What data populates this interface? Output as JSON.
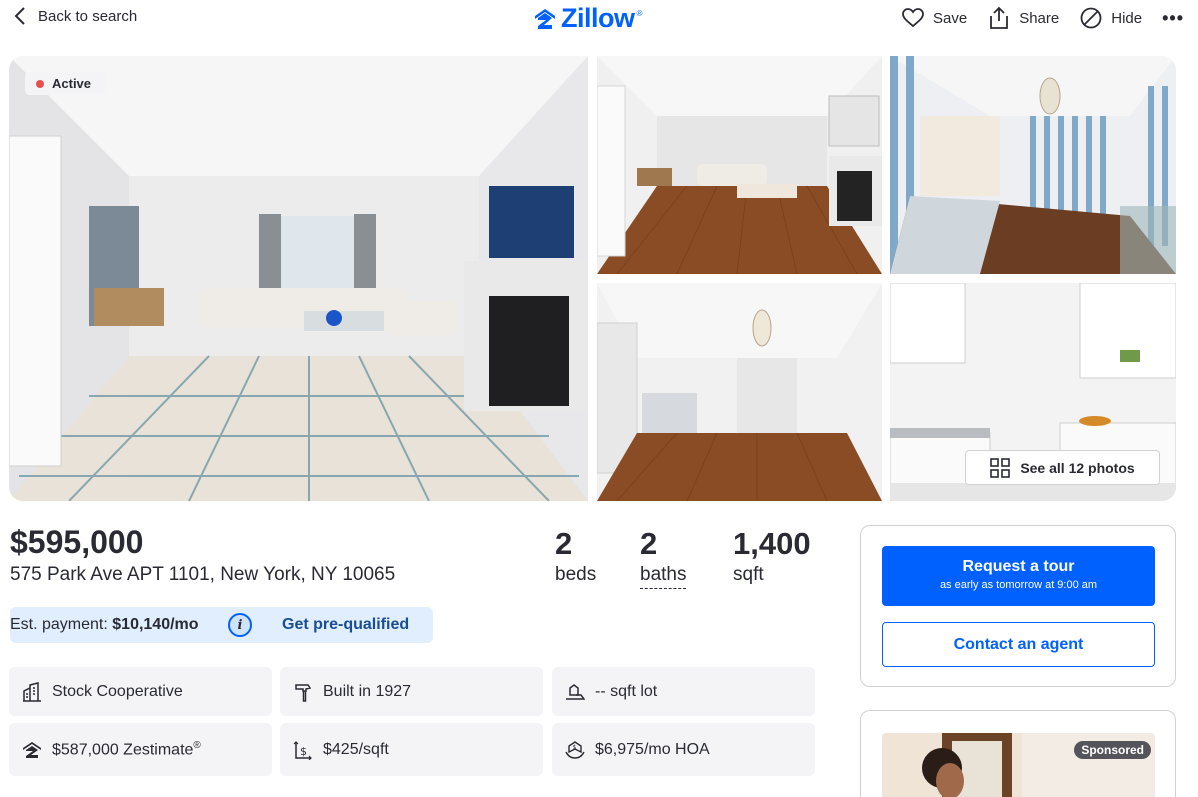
{
  "header": {
    "back_label": "Back to search",
    "logo_text": "Zillow",
    "logo_mark": "®",
    "save_label": "Save",
    "share_label": "Share",
    "hide_label": "Hide",
    "more_label": "•••"
  },
  "gallery": {
    "status_badge": "Active",
    "see_all_label": "See all 12 photos"
  },
  "listing": {
    "price": "$595,000",
    "address": "575 Park Ave APT 1101, New York, NY 10065",
    "beds_value": "2",
    "beds_label": "beds",
    "baths_value": "2",
    "baths_label": "baths",
    "sqft_value": "1,400",
    "sqft_label": "sqft"
  },
  "payment": {
    "prefix": "Est. payment: ",
    "amount": "$10,140/mo",
    "info_icon": "i",
    "prequalify_label": "Get pre-qualified"
  },
  "facts": [
    {
      "icon": "building-icon",
      "text": "Stock Cooperative"
    },
    {
      "icon": "hammer-icon",
      "text": "Built in 1927"
    },
    {
      "icon": "lot-icon",
      "text": "-- sqft lot"
    },
    {
      "icon": "zestimate-icon",
      "text": "$587,000 Zestimate",
      "mark": "®"
    },
    {
      "icon": "price-per-sqft-icon",
      "text": "$425/sqft"
    },
    {
      "icon": "hoa-icon",
      "text": "$6,975/mo HOA"
    }
  ],
  "contact": {
    "tour_label": "Request a tour",
    "tour_sub": "as early as tomorrow at 9:00 am",
    "agent_label": "Contact an agent"
  },
  "ad": {
    "sponsored_label": "Sponsored"
  },
  "colors": {
    "brand": "#0061ff",
    "active_dot": "#e8504d",
    "payment_bg": "#e0eefd"
  }
}
